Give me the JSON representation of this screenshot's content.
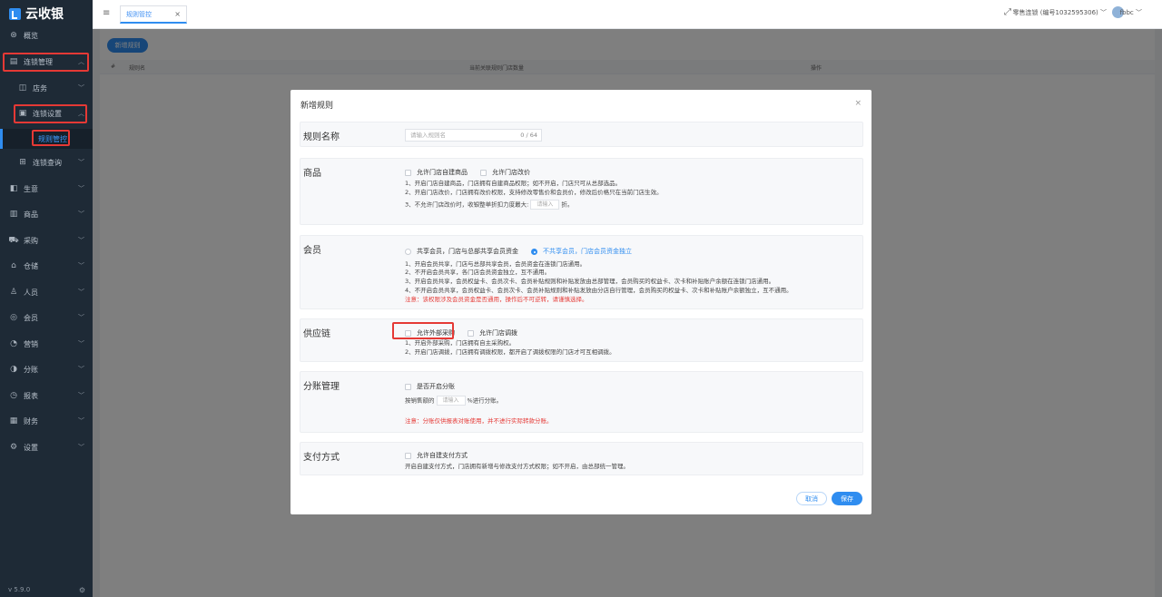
{
  "sidebar": {
    "logo_text": "云收银",
    "version": "v 5.9.0",
    "items": [
      {
        "label": "概览",
        "icon": "dashboard-icon"
      },
      {
        "label": "连锁管理",
        "icon": "chain-icon"
      },
      {
        "label": "店务",
        "icon": "store-icon"
      },
      {
        "label": "连锁设置",
        "icon": "chain-settings-icon"
      },
      {
        "label": "规则管控"
      },
      {
        "label": "连锁查询",
        "icon": "search-icon"
      },
      {
        "label": "生意",
        "icon": "business-icon"
      },
      {
        "label": "商品",
        "icon": "goods-icon"
      },
      {
        "label": "采购",
        "icon": "purchase-icon"
      },
      {
        "label": "仓储",
        "icon": "warehouse-icon"
      },
      {
        "label": "人员",
        "icon": "user-icon"
      },
      {
        "label": "会员",
        "icon": "member-icon"
      },
      {
        "label": "营销",
        "icon": "marketing-icon"
      },
      {
        "label": "分账",
        "icon": "split-icon"
      },
      {
        "label": "报表",
        "icon": "report-icon"
      },
      {
        "label": "财务",
        "icon": "finance-icon"
      },
      {
        "label": "设置",
        "icon": "gear-icon"
      }
    ]
  },
  "topbar": {
    "tab_label": "规则管控",
    "store_name": "零售连锁 (编号1032595306)",
    "user_name": "fbbc"
  },
  "main": {
    "add_button": "新增规则",
    "columns": [
      "#",
      "规则名",
      "当前关联规则门店数量",
      "操作"
    ]
  },
  "modal": {
    "title": "新增规则",
    "rule_name": {
      "label": "规则名称",
      "placeholder": "请输入规则名",
      "counter": "0 / 64"
    },
    "goods": {
      "label": "商品",
      "options": [
        "允许门店自建商品",
        "允许门店改价"
      ],
      "notes": [
        "1、开启门店自建商品，门店拥有自建商品权限；如不开启，门店只可从总部选品。",
        "2、开启门店改价，门店拥有改价权限，支持修改零售价和会员价，修改后价格只在当前门店生效。"
      ],
      "note3_prefix": "3、不允许门店改价时，收银整单折扣力度最大:",
      "note3_placeholder": "请输入",
      "note3_suffix": "折。"
    },
    "member": {
      "label": "会员",
      "options": [
        "共享会员，门店与总部共享会员资金",
        "不共享会员，门店会员资金独立"
      ],
      "notes": [
        "1、开启会员共享，门店与总部共享会员，会员资金在连锁门店通用。",
        "2、不开启会员共享，各门店会员资金独立，互不通用。",
        "3、开启会员共享，会员权益卡、会员次卡、会员补贴规则和补贴发放由总部管理，会员购买的权益卡、次卡和补贴账户余额在连锁门店通用。",
        "4、不开启会员共享，会员权益卡、会员次卡、会员补贴规则和补贴发放由分店自行管理，会员购买的权益卡、次卡和补贴账户余额独立，互不通用。"
      ],
      "warning": "注意：该权限涉及会员资金是否通用，操作后不可逆转，请谨慎选择。"
    },
    "supply": {
      "label": "供应链",
      "options": [
        "允许外部采购",
        "允许门店调拨"
      ],
      "notes": [
        "1、开启外部采购，门店拥有自主采购权。",
        "2、开启门店调拨，门店拥有调拨权限，都开启了调拨权限的门店才可互相调拨。"
      ]
    },
    "split": {
      "label": "分账管理",
      "option": "是否开启分账",
      "text_prefix": "按销售额的",
      "placeholder": "请输入",
      "text_suffix": "%进行分账。",
      "warning": "注意：分账仅供报表对账使用，并不进行实际转款分账。"
    },
    "payment": {
      "label": "支付方式",
      "option": "允许自建支付方式",
      "note": "开启自建支付方式，门店拥有新增与修改支付方式权限；如不开启，由总部统一管理。"
    },
    "cancel": "取消",
    "save": "保存"
  },
  "colors": {
    "accent": "#2f8df0",
    "sidebar_bg": "#1e2a36",
    "highlight": "#e53935"
  }
}
